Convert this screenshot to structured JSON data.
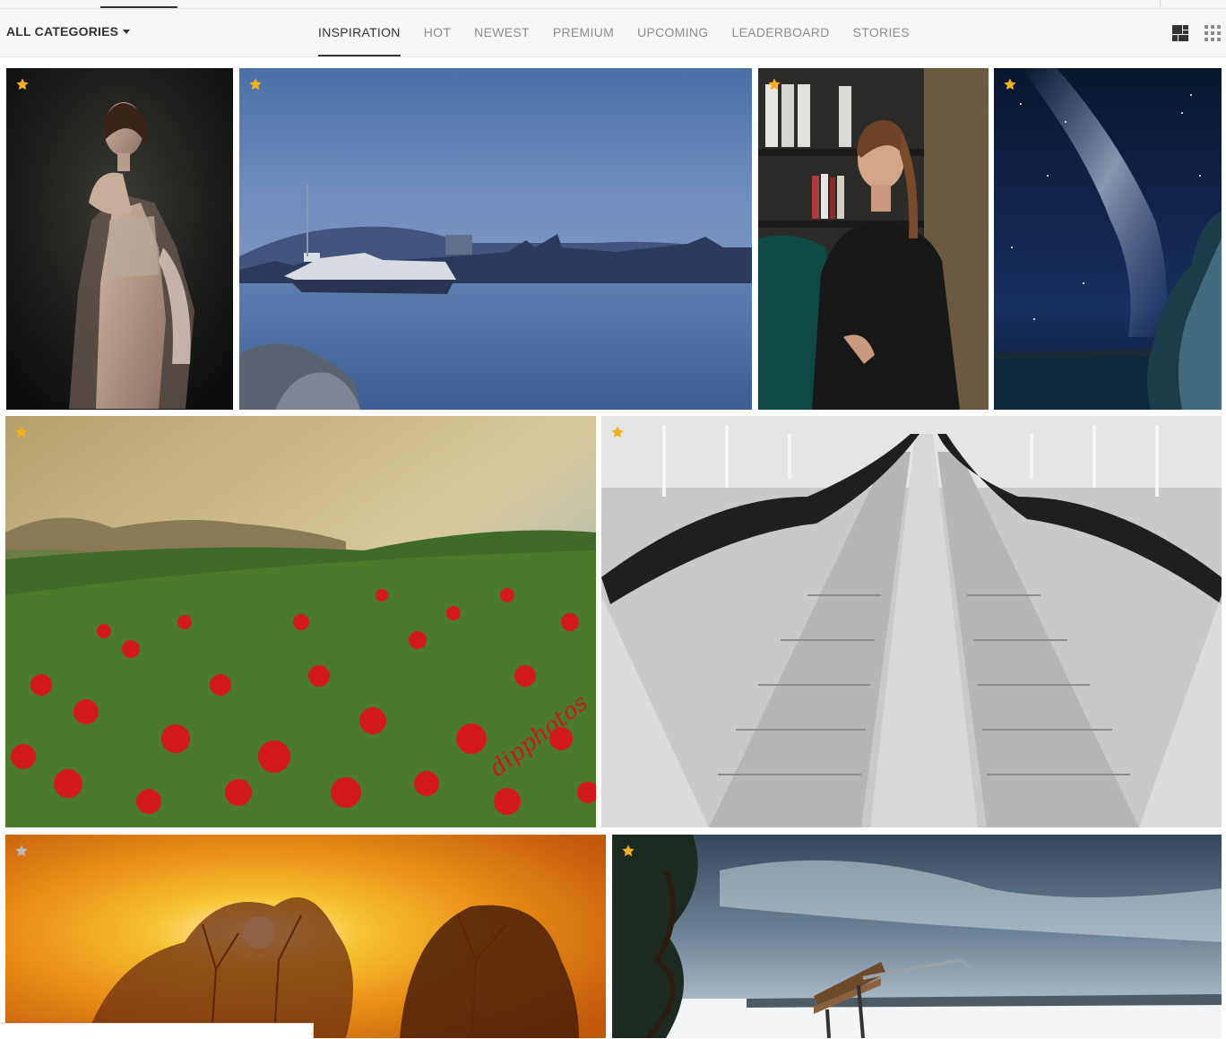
{
  "categories": {
    "label": "ALL CATEGORIES"
  },
  "tabs": [
    {
      "label": "INSPIRATION",
      "active": true
    },
    {
      "label": "HOT"
    },
    {
      "label": "NEWEST"
    },
    {
      "label": "PREMIUM"
    },
    {
      "label": "UPCOMING"
    },
    {
      "label": "LEADERBOARD"
    },
    {
      "label": "STORIES"
    }
  ],
  "view_toggles": [
    {
      "icon": "mosaic-layout-icon",
      "active": true
    },
    {
      "icon": "grid-layout-icon",
      "active": false
    }
  ],
  "photos": [
    {
      "subject": "woman-portrait-dark",
      "featured": true
    },
    {
      "subject": "river-city-dusk",
      "featured": true
    },
    {
      "subject": "woman-bookshelf-portrait",
      "featured": true
    },
    {
      "subject": "milky-way-night-sky",
      "featured": true
    },
    {
      "subject": "poppy-field-mountains",
      "featured": true,
      "watermark": "dipphotos"
    },
    {
      "subject": "escalators-black-white",
      "featured": true
    },
    {
      "subject": "sunset-trees-orange",
      "featured": false
    },
    {
      "subject": "snow-bench-tree",
      "featured": true
    }
  ],
  "colors": {
    "accent_star": "#f2b01e",
    "muted_star": "#b9b9b9",
    "text_active": "#333333",
    "text_inactive": "#8c8c8c"
  }
}
